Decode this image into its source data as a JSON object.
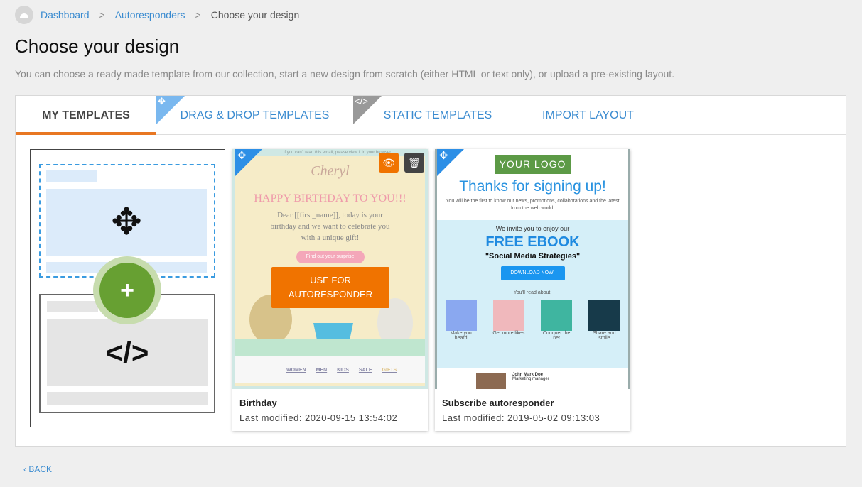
{
  "breadcrumb": {
    "items": [
      "Dashboard",
      "Autoresponders"
    ],
    "current": "Choose your design"
  },
  "page": {
    "title": "Choose your design",
    "description": "You can choose a ready made template from our collection, start a new design from scratch (either HTML or text only), or upload a pre-existing layout."
  },
  "tabs": [
    {
      "label": "MY TEMPLATES",
      "active": true
    },
    {
      "label": "DRAG & DROP TEMPLATES",
      "badge": "move-icon"
    },
    {
      "label": "STATIC TEMPLATES",
      "badge": "code-icon"
    },
    {
      "label": "IMPORT LAYOUT"
    }
  ],
  "new_design": {
    "icon_move": "move-icon",
    "icon_add": "plus-icon",
    "icon_code": "</>"
  },
  "templates": [
    {
      "name": "Birthday",
      "modified": "Last modified: 2020-09-15 13:54:02",
      "use_label": "USE FOR AUTORESPONDER",
      "preview": {
        "top": "If you can't read this email, please view it in your browser",
        "brand": "Cheryl",
        "headline": "HAPPY BIRTHDAY TO YOU!!!",
        "body": "Dear [[first_name]], today is your birthday and we want to celebrate you with a unique gift!",
        "cta": "Find out your surprise",
        "nav": [
          "WOMEN",
          "MEN",
          "KIDS",
          "SALE",
          "GIFTS"
        ]
      }
    },
    {
      "name": "Subscribe autoresponder",
      "modified": "Last modified: 2019-05-02 09:13:03",
      "preview": {
        "logo": "YOUR LOGO",
        "headline": "Thanks for signing up!",
        "sub": "You will be the first to know our news, promotions, collaborations and the latest from the web world.",
        "invite": "We invite you to enjoy our",
        "offer": "FREE EBOOK",
        "book": "\"Social Media Strategies\"",
        "cta": "DOWNLOAD NOW!",
        "read": "You'll read about:",
        "topics": [
          "Make you heard",
          "Get more likes",
          "Conquer the net",
          "Share and smile"
        ],
        "person": "John Mark Doe",
        "role": "Marketing manager"
      }
    }
  ],
  "footer": {
    "back": "‹ BACK"
  },
  "colors": {
    "accent": "#e87722",
    "link": "#3a8bd0",
    "use_button": "#f07300"
  }
}
